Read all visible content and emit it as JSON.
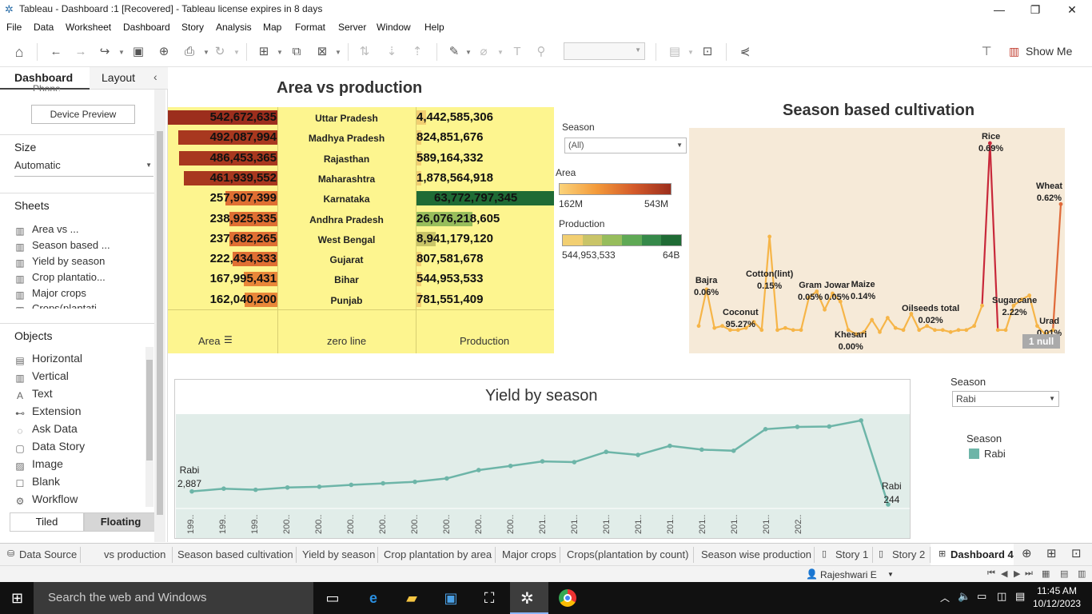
{
  "window": {
    "title": "Tableau - Dashboard :1 [Recovered] - Tableau license expires in 8 days",
    "min": "—",
    "max": "❐",
    "close": "✕"
  },
  "menu": [
    "File",
    "Data",
    "Worksheet",
    "Dashboard",
    "Story",
    "Analysis",
    "Map",
    "Format",
    "Server",
    "Window",
    "Help"
  ],
  "toolbar": {
    "show_me": "Show Me"
  },
  "left_panel": {
    "tab_dashboard": "Dashboard",
    "tab_layout": "Layout",
    "phone_partial": "Phone",
    "device_preview": "Device Preview",
    "size_heading": "Size",
    "size_value": "Automatic",
    "sheets_heading": "Sheets",
    "sheets": [
      "Area vs ...",
      "Season based ...",
      "Yield by season",
      "Crop plantatio...",
      "Major crops",
      "Crops(plantati..."
    ],
    "objects_heading": "Objects",
    "objects": [
      "Horizontal",
      "Vertical",
      "Text",
      "Extension",
      "Ask Data",
      "Data Story",
      "Image",
      "Blank",
      "Workflow"
    ],
    "tiled": "Tiled",
    "floating": "Floating"
  },
  "area_table": {
    "title": "Area vs production",
    "rows": [
      {
        "area": "542,672,635",
        "state": "Uttar Pradesh",
        "production": "4,442,585,306",
        "area_frac": 1.0,
        "prod_frac": 0.07
      },
      {
        "area": "492,087,994",
        "state": "Madhya Pradesh",
        "production": "824,851,676",
        "area_frac": 0.907,
        "prod_frac": 0.013
      },
      {
        "area": "486,453,365",
        "state": "Rajasthan",
        "production": "589,164,332",
        "area_frac": 0.896,
        "prod_frac": 0.009
      },
      {
        "area": "461,939,552",
        "state": "Maharashtra",
        "production": "1,878,564,918",
        "area_frac": 0.851,
        "prod_frac": 0.029
      },
      {
        "area": "257,907,399",
        "state": "Karnataka",
        "production": "63,772,797,345",
        "area_frac": 0.475,
        "prod_frac": 1.0
      },
      {
        "area": "238,925,335",
        "state": "Andhra Pradesh",
        "production": "26,076,218,605",
        "area_frac": 0.44,
        "prod_frac": 0.409
      },
      {
        "area": "237,682,265",
        "state": "West Bengal",
        "production": "8,941,179,120",
        "area_frac": 0.438,
        "prod_frac": 0.14
      },
      {
        "area": "222,434,333",
        "state": "Gujarat",
        "production": "807,581,678",
        "area_frac": 0.41,
        "prod_frac": 0.013
      },
      {
        "area": "167,995,431",
        "state": "Bihar",
        "production": "544,953,533",
        "area_frac": 0.31,
        "prod_frac": 0.0085
      },
      {
        "area": "162,040,200",
        "state": "Punjab",
        "production": "781,551,409",
        "area_frac": 0.299,
        "prod_frac": 0.012
      }
    ],
    "footer": {
      "area": "Area",
      "zero": "zero line",
      "production": "Production"
    }
  },
  "legends": {
    "season_label": "Season",
    "season_value": "(All)",
    "area_label": "Area",
    "area_min": "162M",
    "area_max": "543M",
    "production_label": "Production",
    "production_min": "544,953,533",
    "production_max": "64B"
  },
  "season_chart": {
    "title": "Season based cultivation",
    "labels": [
      {
        "name": "Bajra",
        "value": "0.06%"
      },
      {
        "name": "Coconut",
        "value": "95.27%"
      },
      {
        "name": "Cotton(lint)",
        "value": "0.15%"
      },
      {
        "name": "Gram",
        "value": "0.05%"
      },
      {
        "name": "Jowar",
        "value": "0.05%"
      },
      {
        "name": "Maize",
        "value": "0.14%"
      },
      {
        "name": "Khesari",
        "value": "0.00%"
      },
      {
        "name": "Oilseeds total",
        "value": "0.02%"
      },
      {
        "name": "Rice",
        "value": "0.69%"
      },
      {
        "name": "Sugarcane",
        "value": "2.22%"
      },
      {
        "name": "Wheat",
        "value": "0.62%"
      },
      {
        "name": "Urad",
        "value": "0.01%"
      }
    ],
    "null_badge": "1 null",
    "series": [
      0.08,
      0.26,
      0.07,
      0.08,
      0.06,
      0.06,
      0.07,
      0.1,
      0.06,
      0.52,
      0.06,
      0.07,
      0.06,
      0.06,
      0.22,
      0.25,
      0.16,
      0.24,
      0.2,
      0.06,
      0.04,
      0.05,
      0.11,
      0.05,
      0.12,
      0.07,
      0.06,
      0.14,
      0.06,
      0.08,
      0.06,
      0.06,
      0.05,
      0.06,
      0.06,
      0.08,
      0.18,
      0.98,
      0.06,
      0.06,
      0.18,
      0.21,
      0.23,
      0.08,
      0.04,
      0.06,
      0.68
    ]
  },
  "yield_chart": {
    "title": "Yield by season",
    "first_label": "Rabi",
    "first_value": "2,887",
    "last_label": "Rabi",
    "last_value": "244",
    "values": [
      2887,
      2960,
      2930,
      2990,
      3010,
      3060,
      3100,
      3140,
      3230,
      3450,
      3560,
      3680,
      3660,
      3930,
      3850,
      4090,
      3990,
      3960,
      4530,
      4590,
      4600,
      4760,
      244
    ],
    "x_ticks": [
      "199..",
      "199..",
      "199..",
      "200..",
      "200..",
      "200..",
      "200..",
      "200..",
      "200..",
      "200..",
      "200..",
      "201..",
      "201..",
      "201..",
      "201..",
      "201..",
      "201..",
      "201..",
      "201..",
      "202.."
    ]
  },
  "right_filters": {
    "season_label": "Season",
    "season_value": "Rabi",
    "legend_label": "Season",
    "legend_item": "Rabi",
    "legend_color": "#6db5a8"
  },
  "sheet_tabs": [
    "Data Source",
    "vs production",
    "Season based cultivation",
    "Yield by season",
    "Crop plantation by area",
    "Major crops",
    "Crops(plantation by count)",
    "Season wise production",
    "Story 1",
    "Story 2",
    "Dashboard 4"
  ],
  "status": {
    "user": "Rajeshwari E"
  },
  "taskbar": {
    "search": "Search the web and Windows",
    "time": "11:45 AM",
    "date": "10/12/2023"
  },
  "colors": {
    "table_bg": "#fdf58f",
    "season_bg": "#f6ead8",
    "yield_bg": "#e1ede9",
    "yield_line": "#6db5a8"
  }
}
